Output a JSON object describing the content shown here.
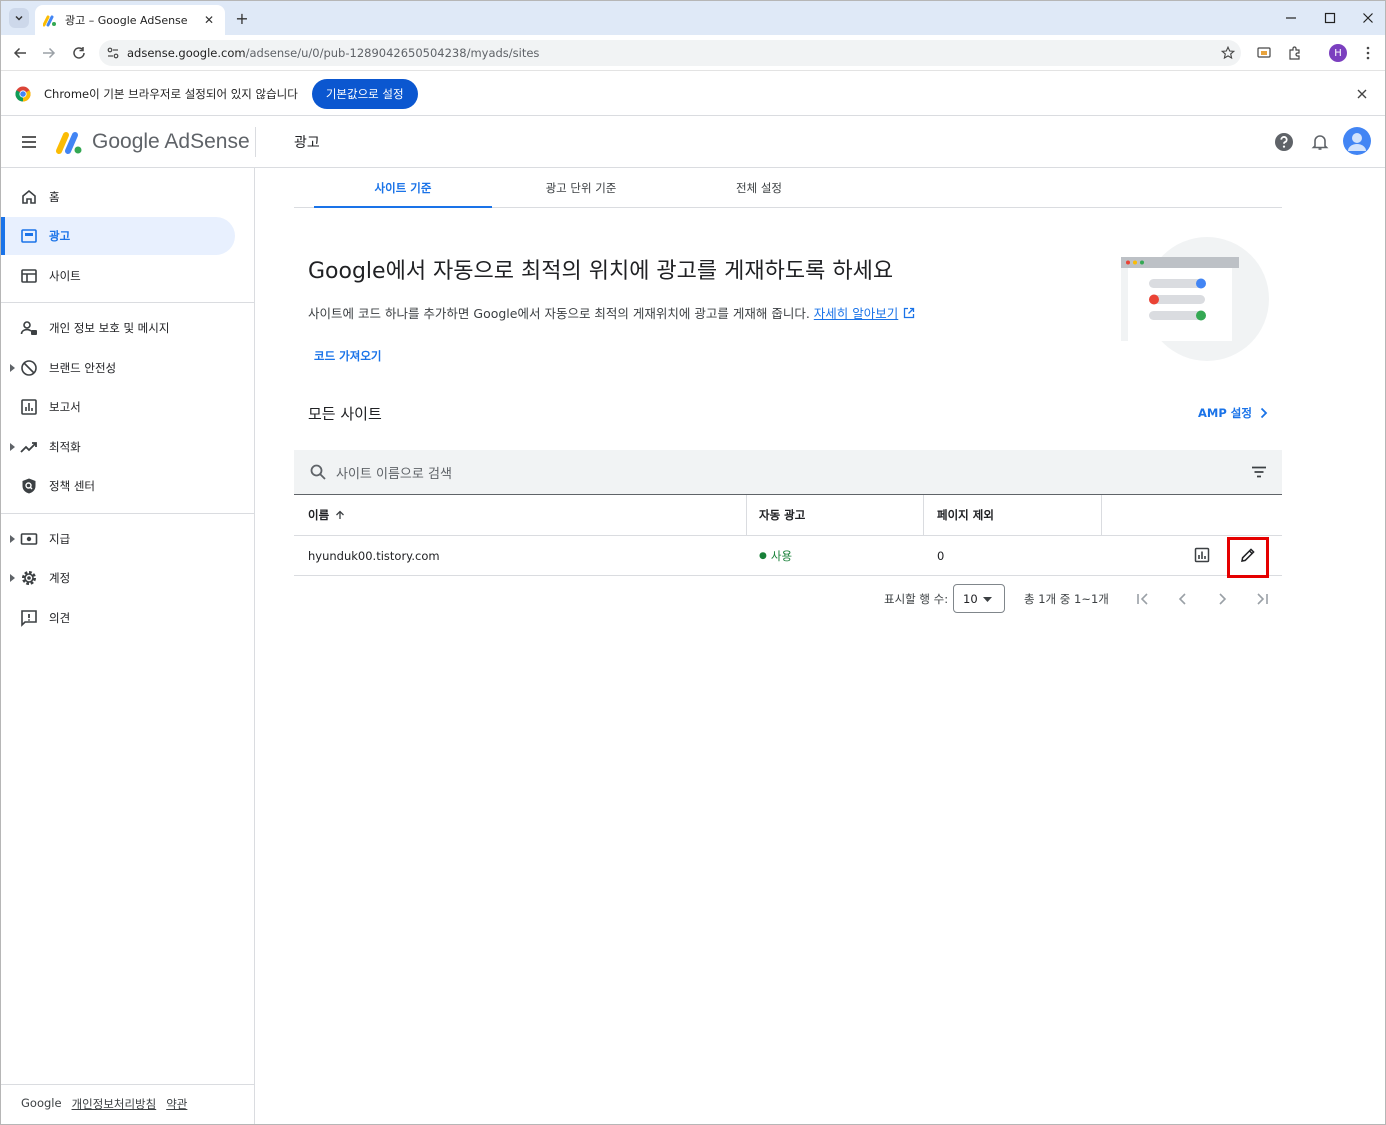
{
  "browser": {
    "tab_title": "광고 – Google AdSense",
    "url_host": "adsense.google.com",
    "url_path": "/adsense/u/0/pub-1289042650504238/myads/sites",
    "profile_initial": "H"
  },
  "infobar": {
    "message": "Chrome이 기본 브라우저로 설정되어 있지 않습니다",
    "button": "기본값으로 설정"
  },
  "app": {
    "brand": "Google AdSense",
    "page_title": "광고"
  },
  "sidebar": {
    "items": [
      {
        "label": "홈",
        "icon": "home-icon"
      },
      {
        "label": "광고",
        "icon": "ads-icon",
        "active": true
      },
      {
        "label": "사이트",
        "icon": "sites-icon"
      },
      {
        "label": "개인 정보 보호 및 메시지",
        "icon": "privacy-icon"
      },
      {
        "label": "브랜드 안전성",
        "icon": "block-icon"
      },
      {
        "label": "보고서",
        "icon": "reports-icon"
      },
      {
        "label": "최적화",
        "icon": "trending-icon"
      },
      {
        "label": "정책 센터",
        "icon": "policy-icon"
      },
      {
        "label": "지급",
        "icon": "payments-icon"
      },
      {
        "label": "계정",
        "icon": "settings-icon"
      },
      {
        "label": "의견",
        "icon": "feedback-icon"
      }
    ],
    "footer": {
      "google": "Google",
      "privacy": "개인정보처리방침",
      "terms": "약관"
    }
  },
  "tabs": [
    {
      "label": "사이트 기준",
      "active": true
    },
    {
      "label": "광고 단위 기준"
    },
    {
      "label": "전체 설정"
    }
  ],
  "hero": {
    "title": "Google에서 자동으로 최적의 위치에 광고를 게재하도록 하세요",
    "description": "사이트에 코드 하나를 추가하면 Google에서 자동으로 최적의 게재위치에 광고를 게재해 줍니다.",
    "learn_more": "자세히 알아보기",
    "get_code": "코드 가져오기"
  },
  "sites": {
    "section_title": "모든 사이트",
    "amp_link": "AMP 설정",
    "search_placeholder": "사이트 이름으로 검색",
    "columns": {
      "name": "이름",
      "auto_ads": "자동 광고",
      "excluded": "페이지 제외"
    },
    "rows": [
      {
        "name": "hyunduk00.tistory.com",
        "auto_ads": "사용",
        "excluded": "0"
      }
    ]
  },
  "pagination": {
    "rows_label": "표시할 행 수:",
    "rows_value": "10",
    "range": "총 1개 중 1~1개"
  },
  "colors": {
    "accent": "#1a73e8",
    "status_on": "#188038",
    "highlight": "#e50000"
  }
}
